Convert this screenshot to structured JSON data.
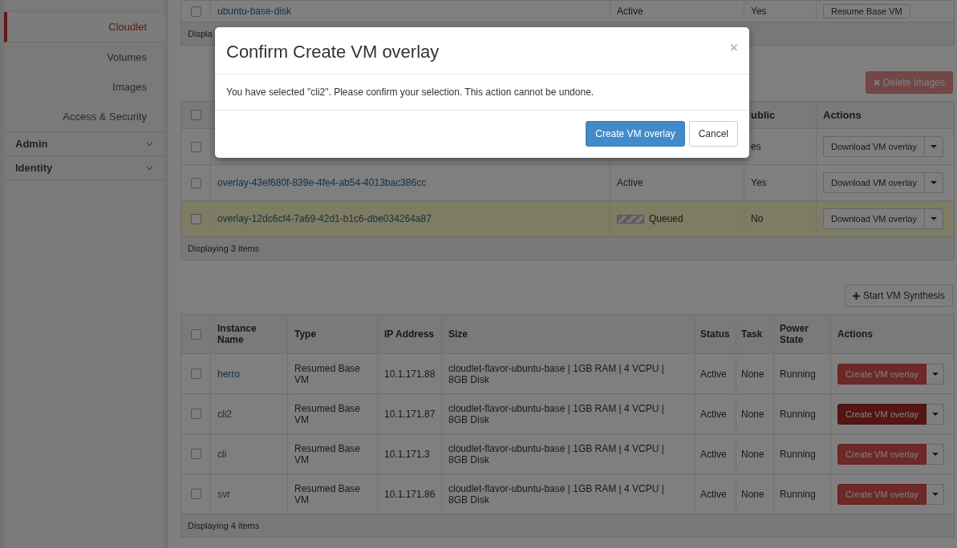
{
  "sidebar": {
    "items": [
      {
        "label": "Cloudlet",
        "selected": true
      },
      {
        "label": "Volumes",
        "selected": false
      },
      {
        "label": "Images",
        "selected": false
      },
      {
        "label": "Access & Security",
        "selected": false
      }
    ],
    "sections": [
      {
        "label": "Admin",
        "expanded": false
      },
      {
        "label": "Identity",
        "expanded": false
      }
    ]
  },
  "base_disk_table": {
    "rows": [
      {
        "checked": false,
        "name": "ubuntu-base-disk",
        "status": "Active",
        "public": "Yes",
        "action": "Resume Base VM"
      }
    ],
    "footer": "Displa"
  },
  "delete_button": {
    "label": "Delete Images",
    "disabled": true
  },
  "overlay_table": {
    "header_checked": false,
    "columns": {
      "public": "ublic",
      "actions": "Actions"
    },
    "rows": [
      {
        "checked": false,
        "in_progress": false,
        "public": "es",
        "action": "Download VM overlay"
      },
      {
        "checked": false,
        "name": "overlay-43ef680f-839e-4fe4-ab54-4013bac386cc",
        "status": "Active",
        "in_progress": false,
        "public": "Yes",
        "action": "Download VM overlay"
      },
      {
        "checked": false,
        "name": "overlay-12dc6cf4-7a69-42d1-b1c6-dbe034264a87",
        "status": "Queued",
        "in_progress": true,
        "public": "No",
        "action": "Download VM overlay"
      }
    ],
    "footer": "Displaying 3 items"
  },
  "synthesis_button": {
    "label": "Start VM Synthesis"
  },
  "instance_table": {
    "header_checked": false,
    "columns": [
      "Instance Name",
      "Type",
      "IP Address",
      "Size",
      "Status",
      "Task",
      "Power State",
      "Actions"
    ],
    "rows": [
      {
        "checked": false,
        "name": "herro",
        "type": "Resumed Base VM",
        "ip": "10.1.171.88",
        "size": "cloudlet-flavor-ubuntu-base | 1GB RAM | 4 VCPU | 8GB Disk",
        "status": "Active",
        "task": "None",
        "power": "Running",
        "action": "Create VM overlay",
        "active": false
      },
      {
        "checked": false,
        "name": "cli2",
        "type": "Resumed Base VM",
        "ip": "10.1.171.87",
        "size": "cloudlet-flavor-ubuntu-base | 1GB RAM | 4 VCPU | 8GB Disk",
        "status": "Active",
        "task": "None",
        "power": "Running",
        "action": "Create VM overlay",
        "active": true
      },
      {
        "checked": false,
        "name": "cli",
        "type": "Resumed Base VM",
        "ip": "10.1.171.3",
        "size": "cloudlet-flavor-ubuntu-base | 1GB RAM | 4 VCPU | 8GB Disk",
        "status": "Active",
        "task": "None",
        "power": "Running",
        "action": "Create VM overlay",
        "active": false
      },
      {
        "checked": false,
        "name": "svr",
        "type": "Resumed Base VM",
        "ip": "10.1.171.86",
        "size": "cloudlet-flavor-ubuntu-base | 1GB RAM | 4 VCPU | 8GB Disk",
        "status": "Active",
        "task": "None",
        "power": "Running",
        "action": "Create VM overlay",
        "active": false
      }
    ],
    "footer": "Displaying 4 items"
  },
  "modal": {
    "title": "Confirm Create VM overlay",
    "close": "×",
    "message": "You have selected \"cli2\". Please confirm your selection. This action cannot be undone.",
    "buttons": [
      {
        "label": "Create VM overlay",
        "kind": "primary"
      },
      {
        "label": "Cancel",
        "kind": "default"
      }
    ]
  }
}
